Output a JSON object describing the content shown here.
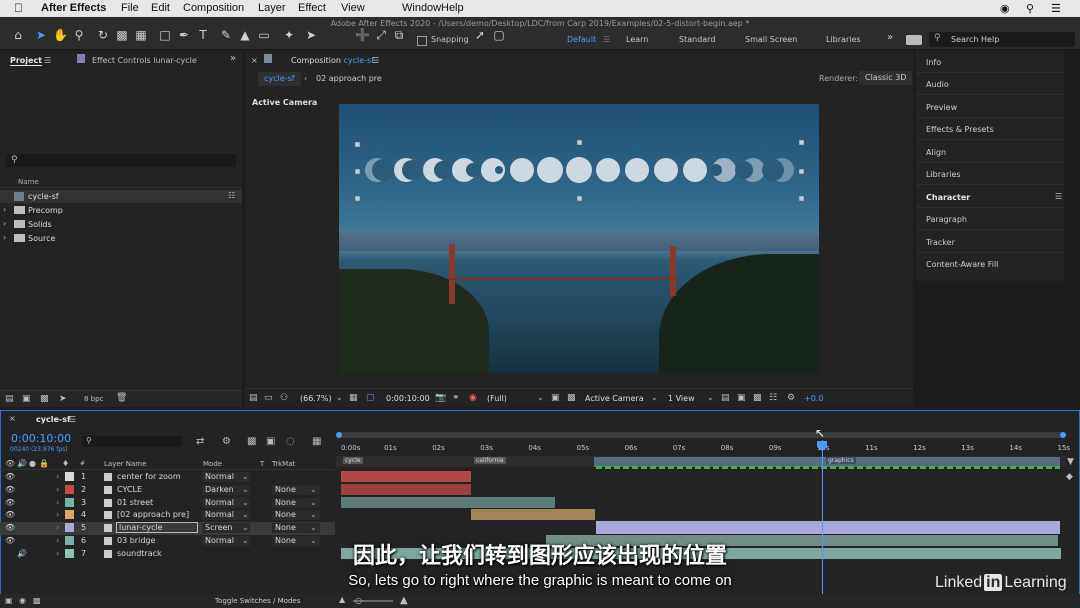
{
  "menubar": {
    "app": "After Effects",
    "items": [
      "File",
      "Edit",
      "Composition",
      "Layer",
      "Effect",
      "View",
      "Window",
      "Help"
    ]
  },
  "title": "Adobe After Effects 2020 - /Users/demo/Desktop/LDC/from Carp 2019/Examples/02-5-distort-begin.aep *",
  "toolbar": {
    "snapping": "Snapping",
    "workspaces": [
      "Default",
      "Learn",
      "Standard",
      "Small Screen",
      "Libraries"
    ],
    "search": "Search Help"
  },
  "project": {
    "tab": "Project",
    "effect_controls": "Effect Controls lunar-cycle",
    "col_name": "Name",
    "items": [
      "cycle-sf",
      "Precomp",
      "Solids",
      "Source"
    ],
    "bpc": "8 bpc"
  },
  "comp": {
    "tab_prefix": "Composition",
    "tab_name": "cycle-sf",
    "crumb1": "cycle-sf",
    "crumb2": "02 approach pre",
    "renderer_label": "Renderer:",
    "renderer": "Classic 3D",
    "camera": "Active Camera",
    "zoom": "(66.7%)",
    "time": "0:00:10:00",
    "quality": "(Full)",
    "camera_sel": "Active Camera",
    "view": "1 View",
    "exposure": "+0.0"
  },
  "right": [
    "Info",
    "Audio",
    "Preview",
    "Effects & Presets",
    "Align",
    "Libraries",
    "Character",
    "Paragraph",
    "Tracker",
    "Content-Aware Fill"
  ],
  "timeline": {
    "tab": "cycle-sf",
    "timecode": "0:00:10:00",
    "fps": "00240 (23.976 fps)",
    "col_layer": "Layer Name",
    "col_mode": "Mode",
    "col_t": "T",
    "col_trk": "TrkMat",
    "toggle": "Toggle Switches / Modes",
    "ticks": [
      "0:00s",
      "01s",
      "02s",
      "03s",
      "04s",
      "05s",
      "06s",
      "07s",
      "08s",
      "09s",
      "10s",
      "11s",
      "12s",
      "13s",
      "14s",
      "15s"
    ],
    "markers": [
      "cycle",
      "california",
      "graphics"
    ],
    "layers": [
      {
        "n": "1",
        "name": "center for zoom",
        "mode": "Normal",
        "trk": "",
        "color": "#d8d8d8"
      },
      {
        "n": "2",
        "name": "CYCLE",
        "mode": "Darken",
        "trk": "None",
        "color": "#c94a4a"
      },
      {
        "n": "3",
        "name": "01 street",
        "mode": "Normal",
        "trk": "None",
        "color": "#77b2a7"
      },
      {
        "n": "4",
        "name": "[02 approach pre]",
        "mode": "Normal",
        "trk": "None",
        "color": "#d8a95f"
      },
      {
        "n": "5",
        "name": "lunar-cycle",
        "mode": "Screen",
        "trk": "None",
        "color": "#a9a9d9"
      },
      {
        "n": "6",
        "name": "03 bridge",
        "mode": "Normal",
        "trk": "None",
        "color": "#77b2a7"
      },
      {
        "n": "7",
        "name": "soundtrack",
        "mode": "",
        "trk": "",
        "color": "#8fc3b8"
      }
    ]
  },
  "subtitles": {
    "zh": "因此，让我们转到图形应该出现的位置",
    "en": "So, lets go to right where the graphic is meant to come on"
  },
  "brand": {
    "a": "Linked",
    "b": "in",
    "c": "Learning"
  }
}
